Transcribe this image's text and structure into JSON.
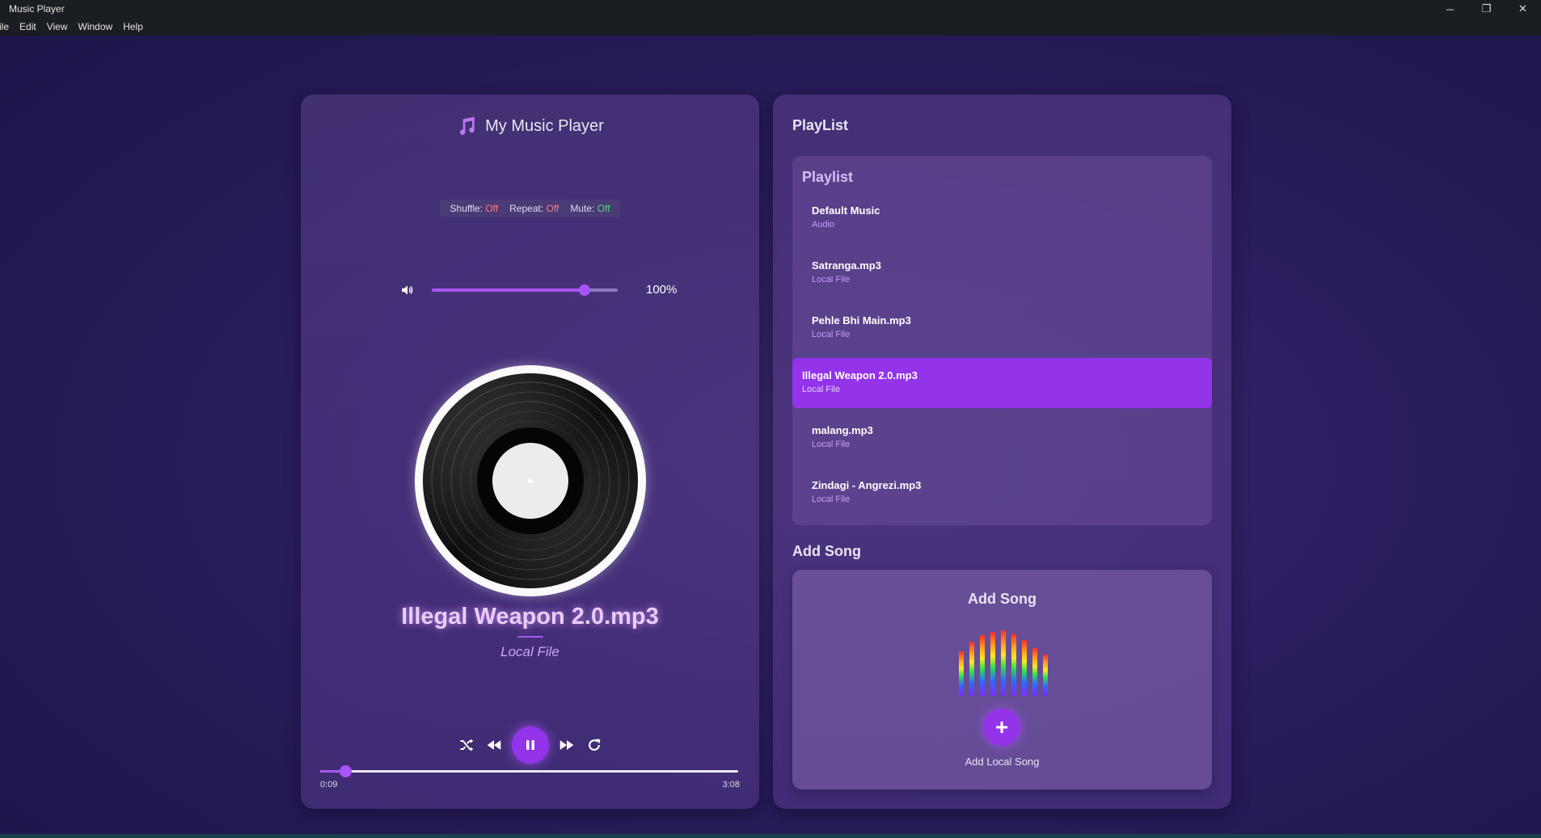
{
  "window": {
    "title": "Music Player",
    "controls": {
      "minimize": "─",
      "restore": "❐",
      "close": "✕"
    }
  },
  "menu": [
    "ile",
    "Edit",
    "View",
    "Window",
    "Help"
  ],
  "player": {
    "header_title": "My Music Player",
    "status": {
      "shuffle_label": "Shuffle:",
      "shuffle_value": "Off",
      "repeat_label": "Repeat:",
      "repeat_value": "Off",
      "mute_label": "Mute:",
      "mute_value": "Off"
    },
    "volume": {
      "level": 1.0,
      "text": "100%"
    },
    "now_playing": {
      "title": "Illegal Weapon 2.0.mp3",
      "source": "Local File"
    },
    "time": {
      "current": "0:09",
      "duration": "3:08",
      "progress": 0.06
    },
    "icons": {
      "logo": "music-note-icon",
      "volume": "speaker-icon",
      "shuffle": "shuffle-icon",
      "prev": "rewind-icon",
      "play": "pause-icon",
      "next": "fast-forward-icon",
      "repeat": "repeat-icon"
    }
  },
  "side": {
    "heading": "PlayList",
    "playlist": {
      "title": "Playlist",
      "items": [
        {
          "name": "Default Music",
          "type": "Audio",
          "active": false
        },
        {
          "name": "Satranga.mp3",
          "type": "Local File",
          "active": false
        },
        {
          "name": "Pehle Bhi Main.mp3",
          "type": "Local File",
          "active": false
        },
        {
          "name": "Illegal Weapon 2.0.mp3",
          "type": "Local File",
          "active": true
        },
        {
          "name": "malang.mp3",
          "type": "Local File",
          "active": false
        },
        {
          "name": "Zindagi - Angrezi.mp3",
          "type": "Local File",
          "active": false
        }
      ]
    },
    "add_section_heading": "Add Song",
    "add_box": {
      "title": "Add Song",
      "button_symbol": "+",
      "button_label": "Add Local Song"
    }
  },
  "colors": {
    "accent": "#9333ea",
    "accent_light": "#a855f7",
    "off": "#ff7a7a",
    "on_green": "#49e07a"
  }
}
